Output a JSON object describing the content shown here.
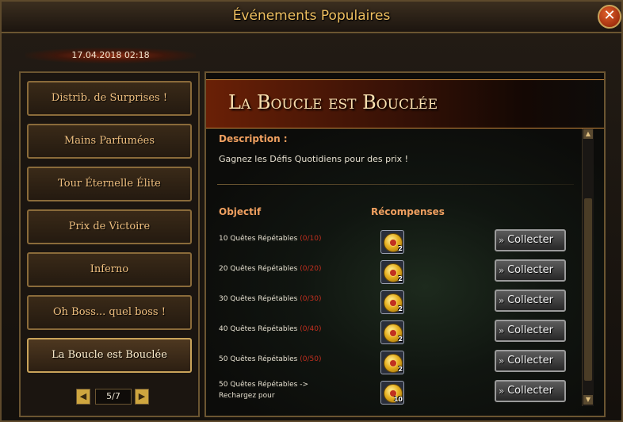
{
  "window": {
    "title": "Événements Populaires",
    "close_label": "✕"
  },
  "date": "17.04.2018 02:18",
  "sidebar": {
    "items": [
      {
        "label": "Distrib. de Surprises !"
      },
      {
        "label": "Mains Parfumées"
      },
      {
        "label": "Tour Éternelle Élite"
      },
      {
        "label": "Prix de Victoire"
      },
      {
        "label": "Inferno"
      },
      {
        "label": "Oh Boss... quel boss !"
      },
      {
        "label": "La Boucle est Bouclée"
      }
    ],
    "active_index": 6
  },
  "pager": {
    "prev_label": "◀",
    "next_label": "▶",
    "page": "5/7"
  },
  "event": {
    "title": "La Boucle est Bouclée",
    "description_label": "Description :",
    "description": "Gagnez les Défis Quotidiens pour des prix !",
    "objective_header": "Objectif",
    "rewards_header": "Récompenses"
  },
  "rows": [
    {
      "objective": "10 Quêtes Répétables",
      "progress": "(0/10)",
      "reward_qty": "2",
      "button": "Collecter"
    },
    {
      "objective": "20 Quêtes Répétables",
      "progress": "(0/20)",
      "reward_qty": "2",
      "button": "Collecter"
    },
    {
      "objective": "30 Quêtes Répétables",
      "progress": "(0/30)",
      "reward_qty": "2",
      "button": "Collecter"
    },
    {
      "objective": "40 Quêtes Répétables",
      "progress": "(0/40)",
      "reward_qty": "2",
      "button": "Collecter"
    },
    {
      "objective": "50 Quêtes Répétables",
      "progress": "(0/50)",
      "reward_qty": "2",
      "button": "Collecter"
    },
    {
      "objective": "50 Quêtes Répétables ->",
      "objective_line2": "Rechargez pour",
      "progress": "",
      "reward_qty": "10",
      "button": "Collecter"
    }
  ],
  "scroll": {
    "up": "▲",
    "down": "▼"
  },
  "colors": {
    "accent": "#f0c060",
    "progress": "#c03020",
    "heading": "#f0a060"
  }
}
